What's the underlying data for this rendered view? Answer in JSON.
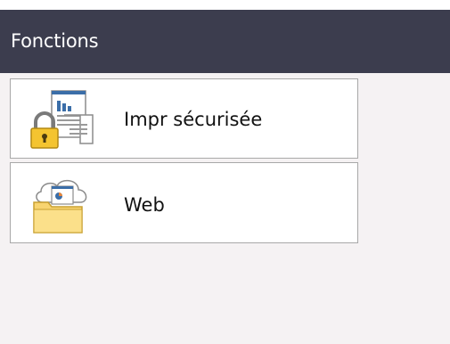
{
  "header": {
    "title": "Fonctions"
  },
  "menu": {
    "items": [
      {
        "label": "Impr sécurisée",
        "icon": "secure-print-icon"
      },
      {
        "label": "Web",
        "icon": "web-folder-icon"
      }
    ]
  },
  "colors": {
    "header_bg": "#3c3d4e",
    "screen_bg": "#f5f2f3",
    "button_border": "#a8a8a8",
    "lock_yellow": "#f4c430",
    "folder_yellow": "#f8d470",
    "chart_blue": "#3b6ea8"
  }
}
